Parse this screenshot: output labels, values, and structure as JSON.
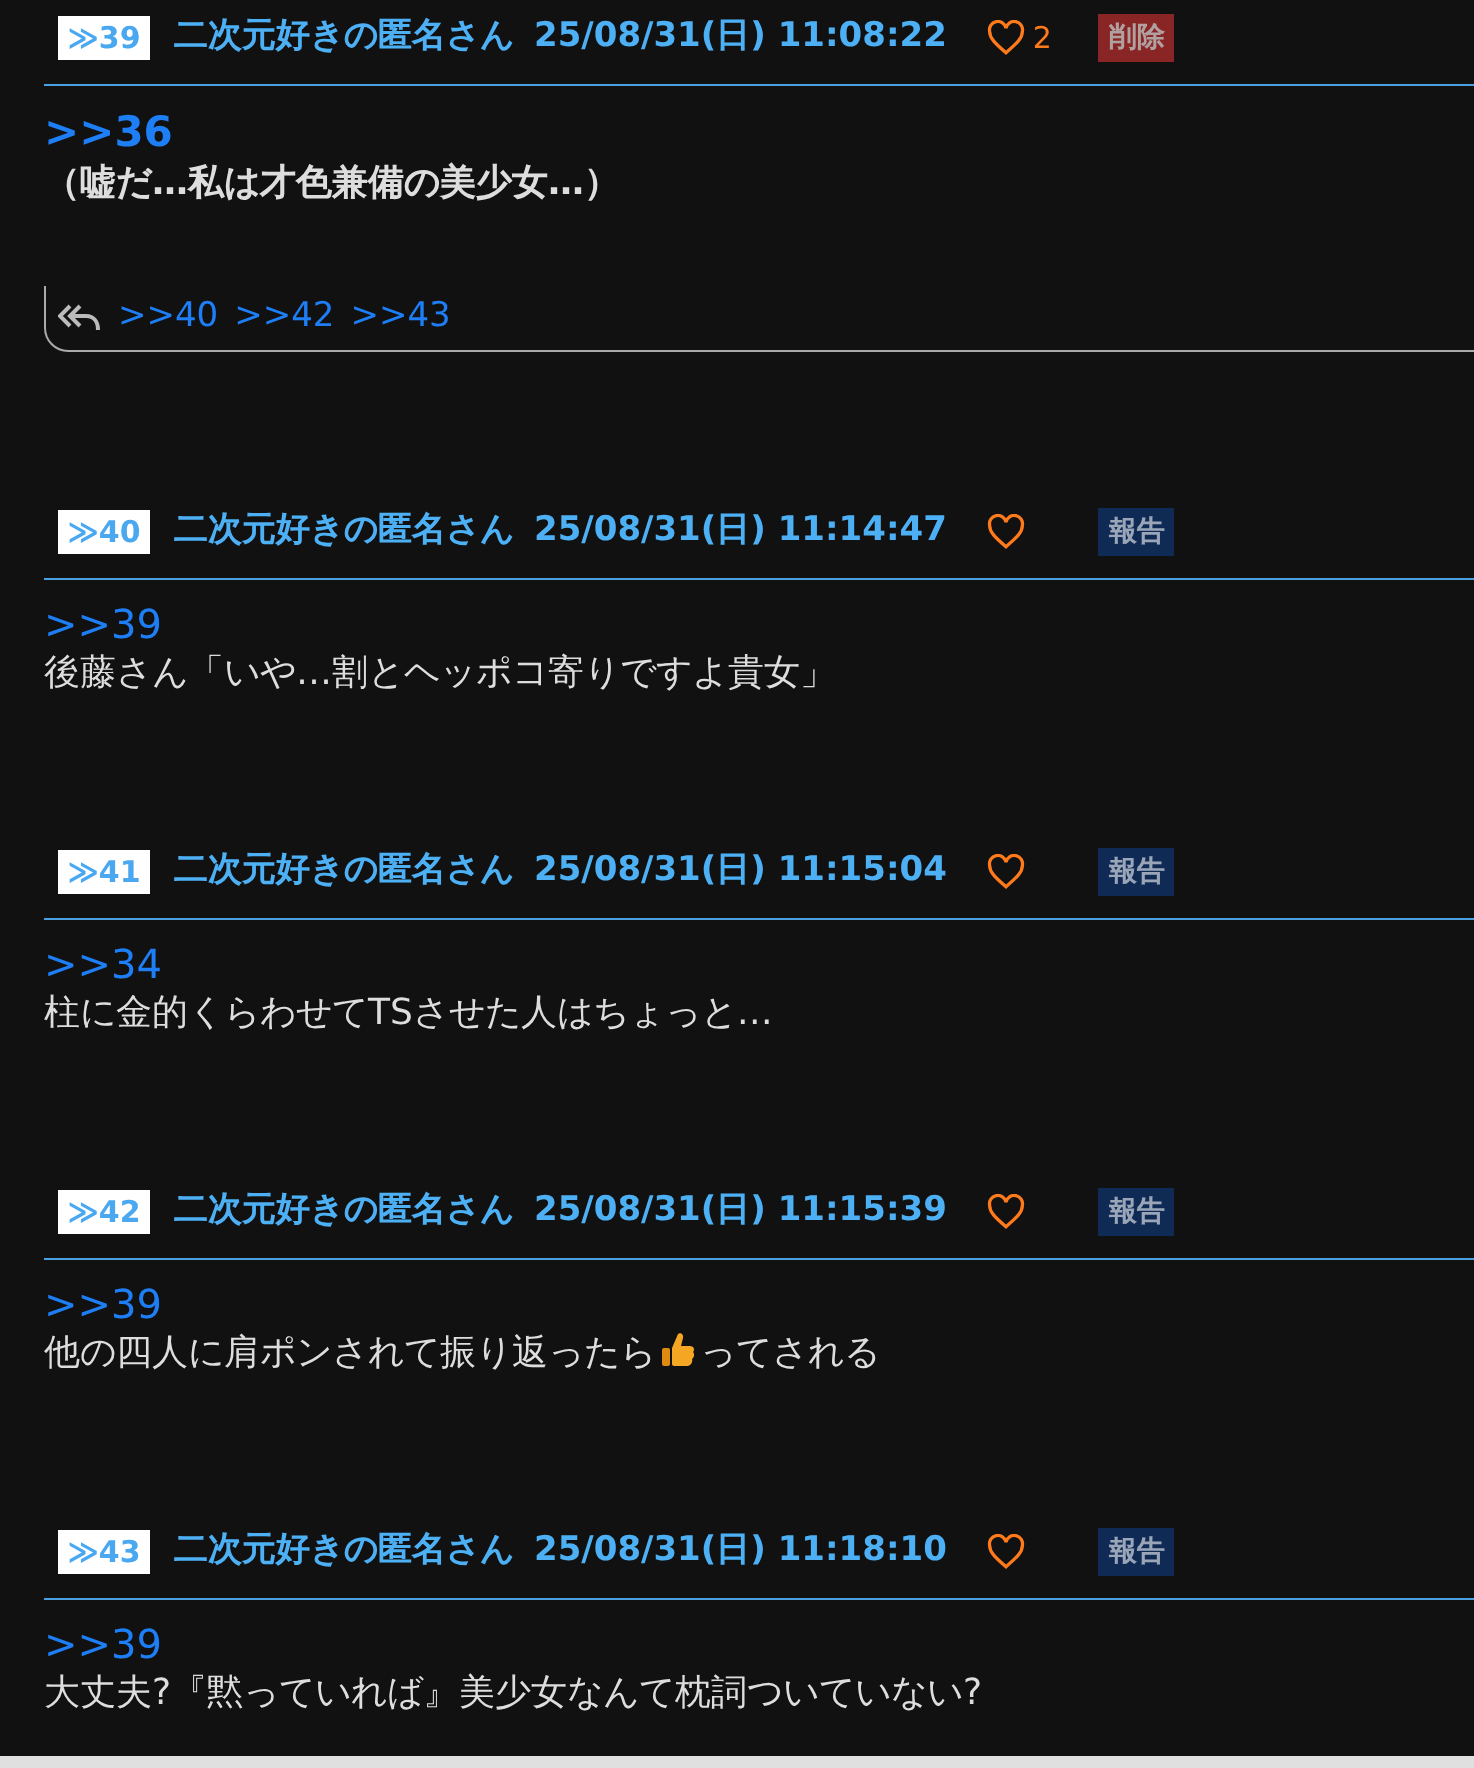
{
  "posts": [
    {
      "number": "≫39",
      "name": "二次元好きの匿名さん",
      "date": "25/08/31(日) 11:08:22",
      "likes": "2",
      "action": {
        "kind": "delete",
        "label": "削除"
      },
      "emphasis": true,
      "ref": ">>36",
      "body": [
        {
          "kind": "text",
          "text": "（嘘だ…私は才色兼備の美少女…）"
        }
      ],
      "replies": [
        ">>40",
        ">>42",
        ">>43"
      ]
    },
    {
      "number": "≫40",
      "name": "二次元好きの匿名さん",
      "date": "25/08/31(日) 11:14:47",
      "action": {
        "kind": "report",
        "label": "報告"
      },
      "emphasis": false,
      "ref": ">>39",
      "body": [
        {
          "kind": "text",
          "text": "後藤さん「いや…割とヘッポコ寄りですよ貴女」"
        }
      ]
    },
    {
      "number": "≫41",
      "name": "二次元好きの匿名さん",
      "date": "25/08/31(日) 11:15:04",
      "action": {
        "kind": "report",
        "label": "報告"
      },
      "emphasis": false,
      "ref": ">>34",
      "body": [
        {
          "kind": "text",
          "text": "柱に金的くらわせてTSさせた人はちょっと…"
        }
      ]
    },
    {
      "number": "≫42",
      "name": "二次元好きの匿名さん",
      "date": "25/08/31(日) 11:15:39",
      "action": {
        "kind": "report",
        "label": "報告"
      },
      "emphasis": false,
      "ref": ">>39",
      "body": [
        {
          "kind": "text",
          "text": "他の四人に肩ポンされて振り返ったら"
        },
        {
          "kind": "thumbs_up"
        },
        {
          "kind": "text",
          "text": "ってされる"
        }
      ]
    },
    {
      "number": "≫43",
      "name": "二次元好きの匿名さん",
      "date": "25/08/31(日) 11:18:10",
      "action": {
        "kind": "report",
        "label": "報告"
      },
      "emphasis": false,
      "ref": ">>39",
      "body": [
        {
          "kind": "text",
          "text": "大丈夫?『黙っていれば』美少女なんて枕詞ついていない?"
        }
      ]
    }
  ]
}
